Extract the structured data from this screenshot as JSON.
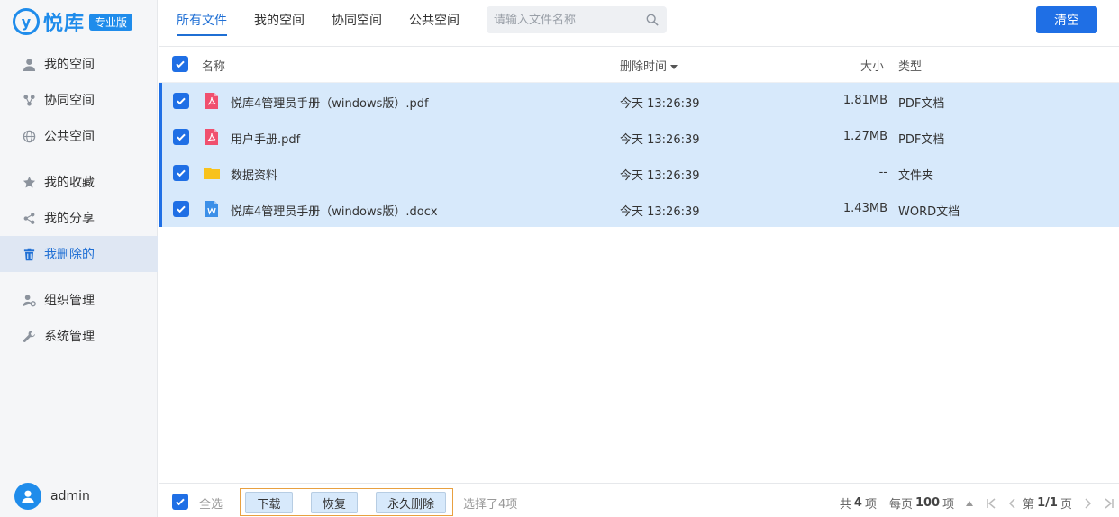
{
  "brand": {
    "name": "悦库",
    "badge": "专业版"
  },
  "sidebar": {
    "groups": [
      [
        {
          "label": "我的空间",
          "icon": "user-icon"
        },
        {
          "label": "协同空间",
          "icon": "share-nodes-icon"
        },
        {
          "label": "公共空间",
          "icon": "globe-icon"
        }
      ],
      [
        {
          "label": "我的收藏",
          "icon": "star-icon"
        },
        {
          "label": "我的分享",
          "icon": "share-icon"
        },
        {
          "label": "我删除的",
          "icon": "trash-icon",
          "active": true
        }
      ],
      [
        {
          "label": "组织管理",
          "icon": "users-gear-icon"
        },
        {
          "label": "系统管理",
          "icon": "wrench-icon"
        }
      ]
    ],
    "user": {
      "name": "admin"
    }
  },
  "tabs": [
    "所有文件",
    "我的空间",
    "协同空间",
    "公共空间"
  ],
  "search": {
    "placeholder": "请输入文件名称",
    "value": ""
  },
  "clear_label": "清空",
  "table": {
    "headers": {
      "name": "名称",
      "time": "删除时间",
      "size": "大小",
      "type": "类型"
    },
    "rows": [
      {
        "name": "悦库4管理员手册（windows版）.pdf",
        "time": "今天 13:26:39",
        "size": "1.81MB",
        "type": "PDF文档",
        "icon": "pdf-file-icon"
      },
      {
        "name": "用户手册.pdf",
        "time": "今天 13:26:39",
        "size": "1.27MB",
        "type": "PDF文档",
        "icon": "pdf-file-icon"
      },
      {
        "name": "数据资料",
        "time": "今天 13:26:39",
        "size": "--",
        "type": "文件夹",
        "icon": "folder-icon"
      },
      {
        "name": "悦库4管理员手册（windows版）.docx",
        "time": "今天 13:26:39",
        "size": "1.43MB",
        "type": "WORD文档",
        "icon": "word-file-icon"
      }
    ]
  },
  "footer": {
    "select_all": "全选",
    "actions": {
      "download": "下载",
      "restore": "恢复",
      "delete_forever": "永久删除"
    },
    "selected_info": "选择了4项",
    "total_prefix": "共",
    "total": "4",
    "total_suffix": "项",
    "per_page_prefix": "每页",
    "per_page": "100",
    "per_page_suffix": "项",
    "page_prefix": "第",
    "page": "1/1",
    "page_suffix": "页"
  },
  "colors": {
    "accent": "#1f6fe5",
    "selected_row": "#d7e9fb",
    "pdf": "#f0506e",
    "folder": "#f8c21c",
    "word": "#3b8fe8"
  }
}
